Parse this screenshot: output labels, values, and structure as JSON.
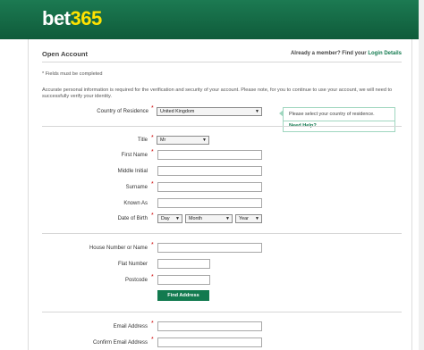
{
  "brand": {
    "logo_text": "bet",
    "logo_num": "365"
  },
  "page": {
    "title": "Open Account",
    "member_prefix": "Already a member? Find your",
    "login_link": "Login Details",
    "required_note": "* Fields must be completed",
    "info_text": "Accurate personal information is required for the verification and security of your account. Please note, for you to continue to use your account, we will need to successfully verify your identity."
  },
  "fields": {
    "country_label": "Country of Residence",
    "country_value": "United Kingdom",
    "title_label": "Title",
    "title_value": "Mr",
    "first_name_label": "First Name",
    "middle_initial_label": "Middle Initial",
    "surname_label": "Surname",
    "known_as_label": "Known As",
    "dob_label": "Date of Birth",
    "dob_day": "Day",
    "dob_month": "Month",
    "dob_year": "Year",
    "house_label": "House Number or Name",
    "flat_label": "Flat Number",
    "postcode_label": "Postcode",
    "find_address_button": "Find Address",
    "email_label": "Email Address",
    "confirm_email_label": "Confirm Email Address"
  },
  "help": {
    "message": "Please select your country of residence.",
    "need_help": "Need Help?"
  },
  "required_marker": "*",
  "colors": {
    "brand_green": "#127a4f",
    "header_green": "#1c7a52",
    "logo_yellow": "#ffe200"
  }
}
